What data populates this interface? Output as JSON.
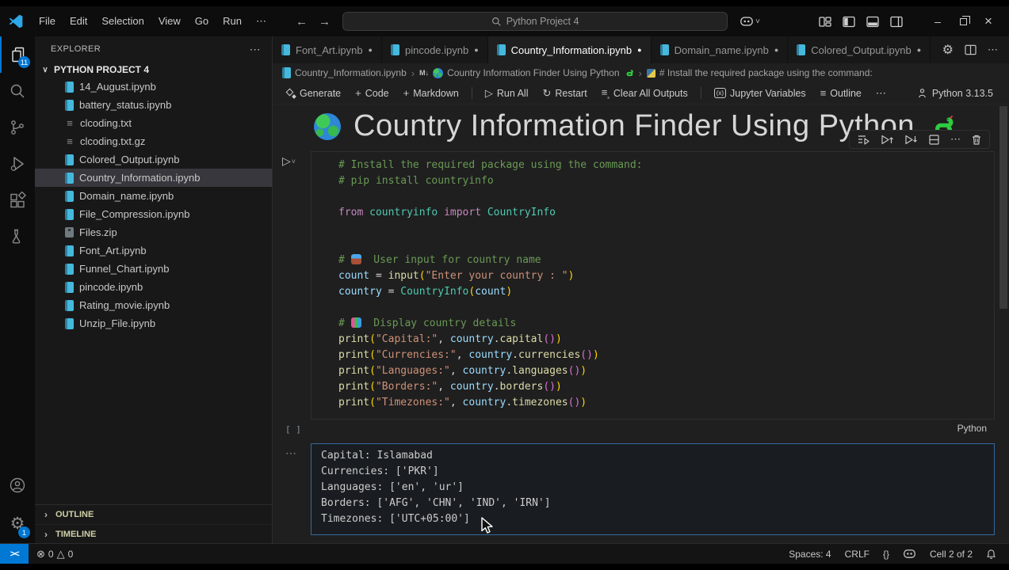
{
  "title_bar": {
    "menus": [
      "File",
      "Edit",
      "Selection",
      "View",
      "Go",
      "Run",
      "⋯"
    ],
    "search": "Python Project 4"
  },
  "icons": {
    "more": "⋯",
    "back": "←",
    "forward": "→",
    "chevron-down": "˅",
    "tree-expanded": "∨",
    "crumb-sep": "›",
    "run": "▷",
    "restart": "↻",
    "plus": "+",
    "list": "≡",
    "sub-x": "ₓ",
    "variables": "(x)",
    "gear": "⚙",
    "error": "⊗",
    "warning": "△",
    "minimize": "–",
    "close": "×",
    "markdown": "M↓",
    "remote": "><",
    "dot": "●",
    "txt-file": "≡",
    "section-chevron": "›"
  },
  "activity_bar": {
    "badges": {
      "explorer": "11",
      "settings": "1"
    }
  },
  "sidebar": {
    "header": "EXPLORER",
    "project": "PYTHON PROJECT 4",
    "files": [
      {
        "name": "14_August.ipynb",
        "type": "notebook"
      },
      {
        "name": "battery_status.ipynb",
        "type": "notebook"
      },
      {
        "name": "clcoding.txt",
        "type": "text"
      },
      {
        "name": "clcoding.txt.gz",
        "type": "text"
      },
      {
        "name": "Colored_Output.ipynb",
        "type": "notebook"
      },
      {
        "name": "Country_Information.ipynb",
        "type": "notebook",
        "selected": true
      },
      {
        "name": "Domain_name.ipynb",
        "type": "notebook"
      },
      {
        "name": "File_Compression.ipynb",
        "type": "notebook"
      },
      {
        "name": "Files.zip",
        "type": "zip"
      },
      {
        "name": "Font_Art.ipynb",
        "type": "notebook"
      },
      {
        "name": "Funnel_Chart.ipynb",
        "type": "notebook"
      },
      {
        "name": "pincode.ipynb",
        "type": "notebook"
      },
      {
        "name": "Rating_movie.ipynb",
        "type": "notebook"
      },
      {
        "name": "Unzip_File.ipynb",
        "type": "notebook"
      }
    ],
    "sections": [
      "OUTLINE",
      "TIMELINE"
    ]
  },
  "editor": {
    "tabs": [
      {
        "name": "Font_Art.ipynb",
        "modified": true
      },
      {
        "name": "pincode.ipynb",
        "modified": true
      },
      {
        "name": "Country_Information.ipynb",
        "modified": true,
        "active": true
      },
      {
        "name": "Domain_name.ipynb",
        "modified": true
      },
      {
        "name": "Colored_Output.ipynb",
        "modified": true
      }
    ],
    "breadcrumb": [
      {
        "icon": "notebook",
        "label": "Country_Information.ipynb"
      },
      {
        "icon": "markdown",
        "lead": "globe",
        "label": "Country Information Finder Using Python",
        "trail": "snake"
      },
      {
        "icon": "python",
        "label": "# Install the required package using the command:"
      }
    ]
  },
  "notebook_toolbar": {
    "items": [
      {
        "icon": "sparkle",
        "label": "Generate"
      },
      {
        "icon": "plus",
        "label": "Code"
      },
      {
        "icon": "plus",
        "label": "Markdown"
      },
      {
        "sep": true
      },
      {
        "icon": "run",
        "label": "Run All"
      },
      {
        "icon": "restart",
        "label": "Restart"
      },
      {
        "icon": "clear",
        "label": "Clear All Outputs"
      },
      {
        "sep": true
      },
      {
        "icon": "vars",
        "label": "Jupyter Variables"
      },
      {
        "icon": "list",
        "label": "Outline"
      },
      {
        "icon": "more",
        "label": ""
      }
    ],
    "kernel": "Python 3.13.5"
  },
  "markdown_cell": {
    "title": "Country Information Finder Using Python"
  },
  "code_cell": {
    "exec_label": "[ ]",
    "language": "Python",
    "lines": [
      [
        {
          "t": "# Install the required package using the command:",
          "c": "cm"
        }
      ],
      [
        {
          "t": "# pip install countryinfo",
          "c": "cm"
        }
      ],
      [],
      [
        {
          "t": "from",
          "c": "kw"
        },
        {
          "t": " ",
          "c": "pl"
        },
        {
          "t": "countryinfo",
          "c": "ty"
        },
        {
          "t": " ",
          "c": "pl"
        },
        {
          "t": "import",
          "c": "kw"
        },
        {
          "t": " ",
          "c": "pl"
        },
        {
          "t": "CountryInfo",
          "c": "ty"
        }
      ],
      [],
      [],
      [
        {
          "t": "# ",
          "c": "cm"
        },
        {
          "icon": "inbox-tray-icon"
        },
        {
          "t": "  User input for country name",
          "c": "cm"
        }
      ],
      [
        {
          "t": "count",
          "c": "vr"
        },
        {
          "t": " = ",
          "c": "pl"
        },
        {
          "t": "input",
          "c": "fn"
        },
        {
          "t": "(",
          "c": "b1"
        },
        {
          "t": "\"Enter your country : \"",
          "c": "st"
        },
        {
          "t": ")",
          "c": "b1"
        }
      ],
      [
        {
          "t": "country",
          "c": "vr"
        },
        {
          "t": " = ",
          "c": "pl"
        },
        {
          "t": "CountryInfo",
          "c": "ty"
        },
        {
          "t": "(",
          "c": "b1"
        },
        {
          "t": "count",
          "c": "vr"
        },
        {
          "t": ")",
          "c": "b1"
        }
      ],
      [],
      [
        {
          "t": "# ",
          "c": "cm"
        },
        {
          "icon": "bar-chart-icon"
        },
        {
          "t": "  Display country details",
          "c": "cm"
        }
      ],
      [
        {
          "t": "print",
          "c": "fn"
        },
        {
          "t": "(",
          "c": "b1"
        },
        {
          "t": "\"Capital:\"",
          "c": "st"
        },
        {
          "t": ", ",
          "c": "pl"
        },
        {
          "t": "country",
          "c": "vr"
        },
        {
          "t": ".",
          "c": "pl"
        },
        {
          "t": "capital",
          "c": "fn"
        },
        {
          "t": "(",
          "c": "b2"
        },
        {
          "t": ")",
          "c": "b2"
        },
        {
          "t": ")",
          "c": "b1"
        }
      ],
      [
        {
          "t": "print",
          "c": "fn"
        },
        {
          "t": "(",
          "c": "b1"
        },
        {
          "t": "\"Currencies:\"",
          "c": "st"
        },
        {
          "t": ", ",
          "c": "pl"
        },
        {
          "t": "country",
          "c": "vr"
        },
        {
          "t": ".",
          "c": "pl"
        },
        {
          "t": "currencies",
          "c": "fn"
        },
        {
          "t": "(",
          "c": "b2"
        },
        {
          "t": ")",
          "c": "b2"
        },
        {
          "t": ")",
          "c": "b1"
        }
      ],
      [
        {
          "t": "print",
          "c": "fn"
        },
        {
          "t": "(",
          "c": "b1"
        },
        {
          "t": "\"Languages:\"",
          "c": "st"
        },
        {
          "t": ", ",
          "c": "pl"
        },
        {
          "t": "country",
          "c": "vr"
        },
        {
          "t": ".",
          "c": "pl"
        },
        {
          "t": "languages",
          "c": "fn"
        },
        {
          "t": "(",
          "c": "b2"
        },
        {
          "t": ")",
          "c": "b2"
        },
        {
          "t": ")",
          "c": "b1"
        }
      ],
      [
        {
          "t": "print",
          "c": "fn"
        },
        {
          "t": "(",
          "c": "b1"
        },
        {
          "t": "\"Borders:\"",
          "c": "st"
        },
        {
          "t": ", ",
          "c": "pl"
        },
        {
          "t": "country",
          "c": "vr"
        },
        {
          "t": ".",
          "c": "pl"
        },
        {
          "t": "borders",
          "c": "fn"
        },
        {
          "t": "(",
          "c": "b2"
        },
        {
          "t": ")",
          "c": "b2"
        },
        {
          "t": ")",
          "c": "b1"
        }
      ],
      [
        {
          "t": "print",
          "c": "fn"
        },
        {
          "t": "(",
          "c": "b1"
        },
        {
          "t": "\"Timezones:\"",
          "c": "st"
        },
        {
          "t": ", ",
          "c": "pl"
        },
        {
          "t": "country",
          "c": "vr"
        },
        {
          "t": ".",
          "c": "pl"
        },
        {
          "t": "timezones",
          "c": "fn"
        },
        {
          "t": "(",
          "c": "b2"
        },
        {
          "t": ")",
          "c": "b2"
        },
        {
          "t": ")",
          "c": "b1"
        }
      ]
    ]
  },
  "output_cell": {
    "lines": [
      "Capital: Islamabad",
      "Currencies: ['PKR']",
      "Languages: ['en', 'ur']",
      "Borders: ['AFG', 'CHN', 'IND', 'IRN']",
      "Timezones: ['UTC+05:00']"
    ]
  },
  "status_bar": {
    "errors": "0",
    "warnings": "0",
    "spaces": "Spaces: 4",
    "eol": "CRLF",
    "lang_mode": "{}",
    "cell_indicator": "Cell 2 of 2"
  }
}
